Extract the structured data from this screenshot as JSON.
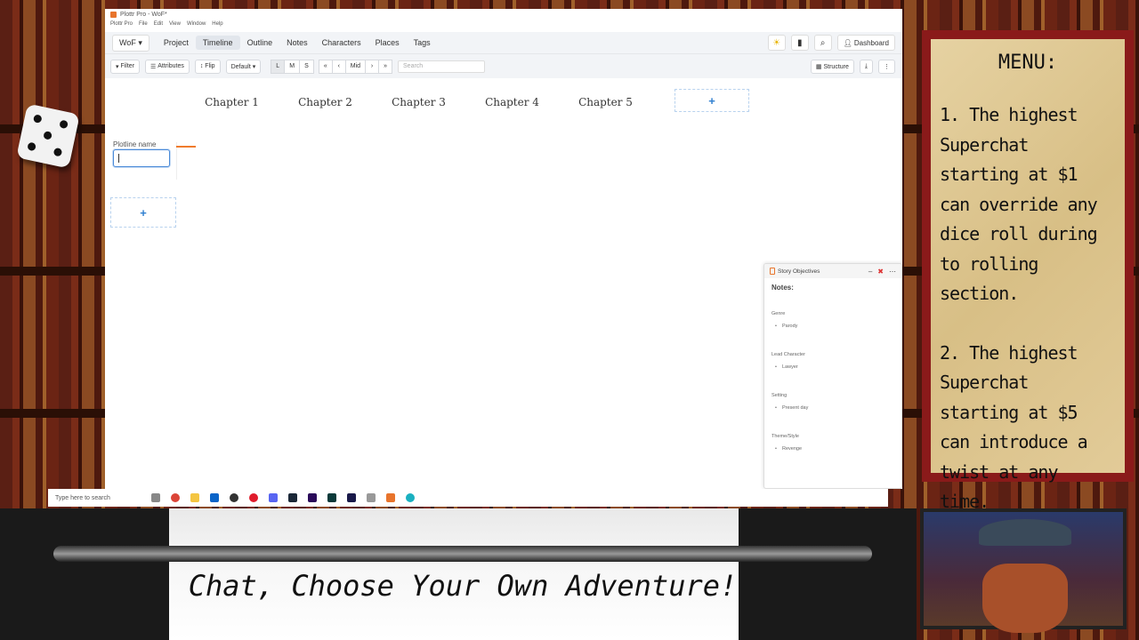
{
  "window": {
    "title": "Plottr Pro - WoF*",
    "menu": [
      "Plottr Pro",
      "File",
      "Edit",
      "View",
      "Window",
      "Help"
    ]
  },
  "nav": {
    "brand": "WoF ▾",
    "tabs": [
      "Project",
      "Timeline",
      "Outline",
      "Notes",
      "Characters",
      "Places",
      "Tags"
    ],
    "active_tab": "Timeline",
    "dashboard_label": "Dashboard"
  },
  "toolbar": {
    "filter": "Filter",
    "attributes": "Attributes",
    "flip": "Flip",
    "default": "Default ▾",
    "sizes": [
      "L",
      "M",
      "S"
    ],
    "scroll": [
      "«",
      "‹",
      "Mid",
      "›",
      "»"
    ],
    "search_placeholder": "Search",
    "structure": "Structure"
  },
  "timeline": {
    "chapters": [
      "Chapter 1",
      "Chapter 2",
      "Chapter 3",
      "Chapter 4",
      "Chapter 5"
    ],
    "add_symbol": "+",
    "plotline_label": "Plotline name"
  },
  "story_objectives": {
    "title": "Story Objectives",
    "notes_header": "Notes:",
    "sections": [
      {
        "label": "Genre",
        "value": "Parody"
      },
      {
        "label": "Lead Character",
        "value": "Lawyer"
      },
      {
        "label": "Setting",
        "value": "Present day"
      },
      {
        "label": "Theme/Style",
        "value": "Revenge"
      }
    ]
  },
  "taskbar": {
    "search_text": "Type here to search"
  },
  "overlay": {
    "menu_title": "MENU:",
    "rule1": "1. The highest Superchat starting at $1 can override any dice roll during to rolling section.",
    "rule2": "2. The highest Superchat starting at $5 can introduce a twist at any time.",
    "caption": "Chat, Choose Your Own Adventure!"
  },
  "colors": {
    "accent_orange": "#f07b2c",
    "link_blue": "#2f7fd0",
    "menu_border": "#8a1a1a"
  }
}
